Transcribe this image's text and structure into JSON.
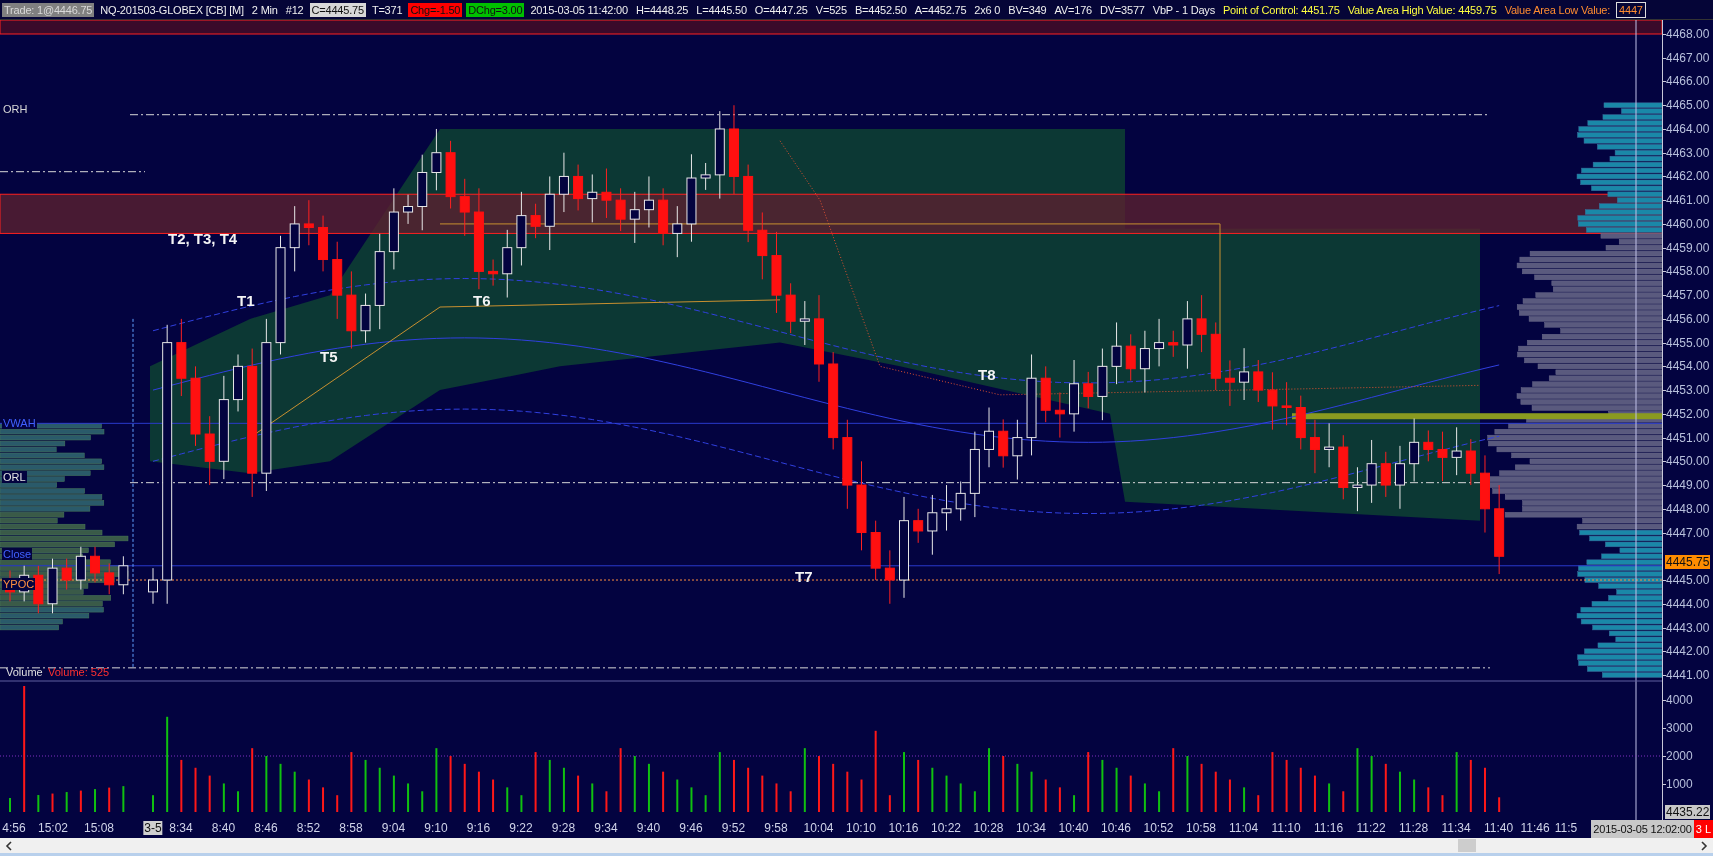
{
  "top_bar": {
    "items": [
      {
        "text": "Trade: 1@4446.75",
        "kind": "muted"
      },
      {
        "text": "NQ-201503-GLOBEX [CB] [M]",
        "kind": "plain"
      },
      {
        "text": "2 Min",
        "kind": "plain"
      },
      {
        "text": "#12",
        "kind": "plain"
      },
      {
        "text": "C=4445.75",
        "kind": "light"
      },
      {
        "text": "T=371",
        "kind": "plain"
      },
      {
        "text": "Chg=-1.50",
        "kind": "down"
      },
      {
        "text": "DChg=3.00",
        "kind": "up"
      },
      {
        "text": "2015-03-05 11:42:00",
        "kind": "plain"
      },
      {
        "text": "H=4448.25",
        "kind": "plain"
      },
      {
        "text": "L=4445.50",
        "kind": "plain"
      },
      {
        "text": "O=4447.25",
        "kind": "plain"
      },
      {
        "text": "V=525",
        "kind": "plain"
      },
      {
        "text": "B=4452.50",
        "kind": "plain"
      },
      {
        "text": "A=4452.75",
        "kind": "plain"
      },
      {
        "text": "2x6 0",
        "kind": "plain"
      },
      {
        "text": "BV=349",
        "kind": "plain"
      },
      {
        "text": "AV=176",
        "kind": "plain"
      },
      {
        "text": "DV=3577",
        "kind": "plain"
      },
      {
        "text": "VbP - 1 Days",
        "kind": "plain"
      },
      {
        "text": "Point of Control: 4451.75",
        "kind": "yellow"
      },
      {
        "text": "Value Area High Value: 4459.75",
        "kind": "yellow"
      },
      {
        "text": "Value Area Low Value:",
        "kind": "orange"
      },
      {
        "text": "4447",
        "kind": "boxed"
      }
    ]
  },
  "chart": {
    "level_labels": [
      {
        "text": "ORH",
        "kind": "orh"
      },
      {
        "text": "VWAH",
        "kind": "vwah"
      },
      {
        "text": "ORL",
        "kind": "orl"
      },
      {
        "text": "Close",
        "kind": "close"
      },
      {
        "text": "YPOC",
        "kind": "ypoc"
      }
    ],
    "trade_labels": [
      "T2, T3, T4",
      "T1",
      "T5",
      "T6",
      "T7",
      "T8"
    ],
    "price_axis": [
      "4468.00",
      "4467.00",
      "4466.00",
      "4465.00",
      "4464.00",
      "4463.00",
      "4462.00",
      "4461.00",
      "4460.00",
      "4459.00",
      "4458.00",
      "4457.00",
      "4456.00",
      "4455.00",
      "4454.00",
      "4453.00",
      "4452.00",
      "4451.00",
      "4450.00",
      "4449.00",
      "4448.00",
      "4447.00",
      "4445.00",
      "4444.00",
      "4443.00",
      "4442.00",
      "4441.00"
    ],
    "last_price": "4445.75",
    "volume_panel": {
      "title": "Volume",
      "reading": "Volume: 525",
      "axis": [
        "4000",
        "3000",
        "2000",
        "1000"
      ]
    },
    "scale_min": "4435.22"
  },
  "time_axis": {
    "labels": [
      {
        "text": "4:56",
        "kind": "time"
      },
      {
        "text": "15:02",
        "kind": "time"
      },
      {
        "text": "15:08",
        "kind": "time"
      },
      {
        "text": "3-5",
        "kind": "date"
      },
      {
        "text": "8:34",
        "kind": "time"
      },
      {
        "text": "8:40",
        "kind": "time"
      },
      {
        "text": "8:46",
        "kind": "time"
      },
      {
        "text": "8:52",
        "kind": "time"
      },
      {
        "text": "8:58",
        "kind": "time"
      },
      {
        "text": "9:04",
        "kind": "time"
      },
      {
        "text": "9:10",
        "kind": "time"
      },
      {
        "text": "9:16",
        "kind": "time"
      },
      {
        "text": "9:22",
        "kind": "time"
      },
      {
        "text": "9:28",
        "kind": "time"
      },
      {
        "text": "9:34",
        "kind": "time"
      },
      {
        "text": "9:40",
        "kind": "time"
      },
      {
        "text": "9:46",
        "kind": "time"
      },
      {
        "text": "9:52",
        "kind": "time"
      },
      {
        "text": "9:58",
        "kind": "time"
      },
      {
        "text": "10:04",
        "kind": "time"
      },
      {
        "text": "10:10",
        "kind": "time"
      },
      {
        "text": "10:16",
        "kind": "time"
      },
      {
        "text": "10:22",
        "kind": "time"
      },
      {
        "text": "10:28",
        "kind": "time"
      },
      {
        "text": "10:34",
        "kind": "time"
      },
      {
        "text": "10:40",
        "kind": "time"
      },
      {
        "text": "10:46",
        "kind": "time"
      },
      {
        "text": "10:52",
        "kind": "time"
      },
      {
        "text": "10:58",
        "kind": "time"
      },
      {
        "text": "11:04",
        "kind": "time"
      },
      {
        "text": "11:10",
        "kind": "time"
      },
      {
        "text": "11:16",
        "kind": "time"
      },
      {
        "text": "11:22",
        "kind": "time"
      },
      {
        "text": "11:28",
        "kind": "time"
      },
      {
        "text": "11:34",
        "kind": "time"
      },
      {
        "text": "11:40",
        "kind": "time"
      },
      {
        "text": "11:46",
        "kind": "time"
      },
      {
        "text": "11:5",
        "kind": "time"
      }
    ],
    "cursor_time": "2015-03-05 12:02:00",
    "flag": "3 L"
  }
}
